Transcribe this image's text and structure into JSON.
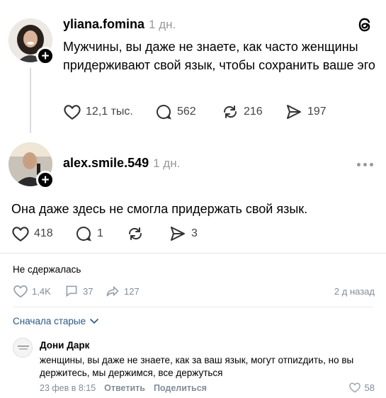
{
  "post1": {
    "username": "yliana.fomina",
    "time": "1 дн.",
    "text": "Мужчины, вы даже не знаете, как часто женщины придерживают свой язык, чтобы сохранить ваше эго",
    "likes": "12,1 тыс.",
    "replies": "562",
    "reposts": "216",
    "shares": "197"
  },
  "post2": {
    "username": "alex.smile.549",
    "time": "1 дн.",
    "text": "Она даже здесь не смогла придержать свой язык.",
    "likes": "418",
    "replies": "1",
    "shares": "3"
  },
  "vk_post": {
    "caption": "Не сдержалась",
    "likes": "1,4K",
    "comments": "37",
    "shares": "127",
    "time": "2 д назад"
  },
  "comments_sort": "Сначала старые",
  "comment": {
    "author": "Дони Дарк",
    "text": "женщины, вы даже не знаете, как за ваш язык, могут отпиzдить, но вы держитесь, мы держимся, все держуться",
    "date": "23 фев в 8:15",
    "reply_label": "Ответить",
    "share_label": "Поделиться",
    "likes": "58"
  },
  "colors": {
    "vk_blue": "#2a5885",
    "vk_gray": "#818c99"
  }
}
